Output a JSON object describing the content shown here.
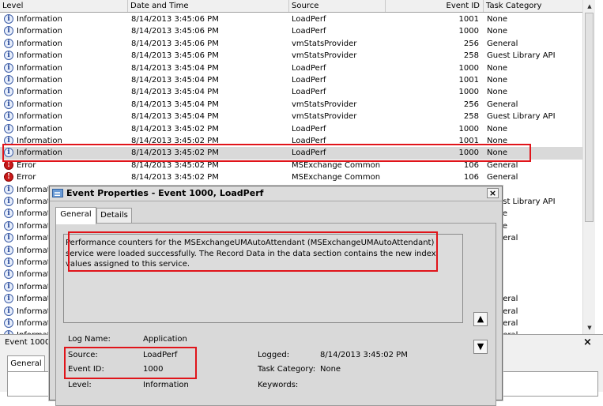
{
  "columns": {
    "level": "Level",
    "datetime": "Date and Time",
    "source": "Source",
    "eventid": "Event ID",
    "category": "Task Category"
  },
  "colors": {
    "highlight": "#e0141a",
    "selected_row": "#d9d9d9"
  },
  "rows": [
    {
      "icon": "info-icon",
      "level": "Information",
      "datetime": "8/14/2013 3:45:06 PM",
      "source": "LoadPerf",
      "eventid": "1001",
      "category": "None"
    },
    {
      "icon": "info-icon",
      "level": "Information",
      "datetime": "8/14/2013 3:45:06 PM",
      "source": "LoadPerf",
      "eventid": "1000",
      "category": "None"
    },
    {
      "icon": "info-icon",
      "level": "Information",
      "datetime": "8/14/2013 3:45:06 PM",
      "source": "vmStatsProvider",
      "eventid": "256",
      "category": "General"
    },
    {
      "icon": "info-icon",
      "level": "Information",
      "datetime": "8/14/2013 3:45:06 PM",
      "source": "vmStatsProvider",
      "eventid": "258",
      "category": "Guest Library API"
    },
    {
      "icon": "info-icon",
      "level": "Information",
      "datetime": "8/14/2013 3:45:04 PM",
      "source": "LoadPerf",
      "eventid": "1000",
      "category": "None"
    },
    {
      "icon": "info-icon",
      "level": "Information",
      "datetime": "8/14/2013 3:45:04 PM",
      "source": "LoadPerf",
      "eventid": "1001",
      "category": "None"
    },
    {
      "icon": "info-icon",
      "level": "Information",
      "datetime": "8/14/2013 3:45:04 PM",
      "source": "LoadPerf",
      "eventid": "1000",
      "category": "None"
    },
    {
      "icon": "info-icon",
      "level": "Information",
      "datetime": "8/14/2013 3:45:04 PM",
      "source": "vmStatsProvider",
      "eventid": "256",
      "category": "General"
    },
    {
      "icon": "info-icon",
      "level": "Information",
      "datetime": "8/14/2013 3:45:04 PM",
      "source": "vmStatsProvider",
      "eventid": "258",
      "category": "Guest Library API"
    },
    {
      "icon": "info-icon",
      "level": "Information",
      "datetime": "8/14/2013 3:45:02 PM",
      "source": "LoadPerf",
      "eventid": "1000",
      "category": "None"
    },
    {
      "icon": "info-icon",
      "level": "Information",
      "datetime": "8/14/2013 3:45:02 PM",
      "source": "LoadPerf",
      "eventid": "1001",
      "category": "None"
    },
    {
      "icon": "info-icon",
      "level": "Information",
      "datetime": "8/14/2013 3:45:02 PM",
      "source": "LoadPerf",
      "eventid": "1000",
      "category": "None",
      "selected": true
    },
    {
      "icon": "error-icon",
      "level": "Error",
      "datetime": "8/14/2013 3:45:02 PM",
      "source": "MSExchange Common",
      "eventid": "106",
      "category": "General"
    },
    {
      "icon": "error-icon",
      "level": "Error",
      "datetime": "8/14/2013 3:45:02 PM",
      "source": "MSExchange Common",
      "eventid": "106",
      "category": "General"
    },
    {
      "icon": "info-icon",
      "level": "Informati",
      "datetime": "",
      "source": "",
      "eventid": "",
      "category": ""
    },
    {
      "icon": "info-icon",
      "level": "Informati",
      "datetime": "",
      "source": "",
      "eventid": "",
      "category": "Guest Library API"
    },
    {
      "icon": "info-icon",
      "level": "Informati",
      "datetime": "",
      "source": "",
      "eventid": "",
      "category": "None"
    },
    {
      "icon": "info-icon",
      "level": "Informati",
      "datetime": "",
      "source": "",
      "eventid": "",
      "category": "None"
    },
    {
      "icon": "info-icon",
      "level": "Informati",
      "datetime": "",
      "source": "",
      "eventid": "",
      "category": "General"
    },
    {
      "icon": "info-icon",
      "level": "Informati",
      "datetime": "",
      "source": "",
      "eventid": "",
      "category": "e"
    },
    {
      "icon": "info-icon",
      "level": "Informati",
      "datetime": "",
      "source": "",
      "eventid": "",
      "category": "e"
    },
    {
      "icon": "info-icon",
      "level": "Informati",
      "datetime": "",
      "source": "",
      "eventid": "",
      "category": "e"
    },
    {
      "icon": "info-icon",
      "level": "Informati",
      "datetime": "",
      "source": "",
      "eventid": "",
      "category": "e"
    },
    {
      "icon": "info-icon",
      "level": "Informati",
      "datetime": "",
      "source": "",
      "eventid": "",
      "category": "General"
    },
    {
      "icon": "info-icon",
      "level": "Informati",
      "datetime": "",
      "source": "",
      "eventid": "",
      "category": "General"
    },
    {
      "icon": "info-icon",
      "level": "Informati",
      "datetime": "",
      "source": "",
      "eventid": "",
      "category": "General"
    },
    {
      "icon": "info-icon",
      "level": "Informati",
      "datetime": "",
      "source": "",
      "eventid": "",
      "category": "General"
    }
  ],
  "bottom": {
    "title": "Event 1000,",
    "close": "×",
    "tab": "General"
  },
  "dialog": {
    "title": "Event Properties - Event 1000, LoadPerf",
    "close": "×",
    "tabs": {
      "general": "General",
      "details": "Details"
    },
    "description": [
      "Performance counters for the MSExchangeUMAutoAttendant (MSExchangeUMAutoAttendant)",
      "service were loaded successfully. The Record Data in the data section contains the new index",
      "values assigned to this service."
    ],
    "up": "▲",
    "down": "▼",
    "fields": {
      "log_name_label": "Log Name:",
      "log_name": "Application",
      "source_label": "Source:",
      "source": "LoadPerf",
      "logged_label": "Logged:",
      "logged": "8/14/2013 3:45:02 PM",
      "event_id_label": "Event ID:",
      "event_id": "1000",
      "task_category_label": "Task Category:",
      "task_category": "None",
      "level_label": "Level:",
      "level": "Information",
      "keywords_label": "Keywords:"
    }
  }
}
